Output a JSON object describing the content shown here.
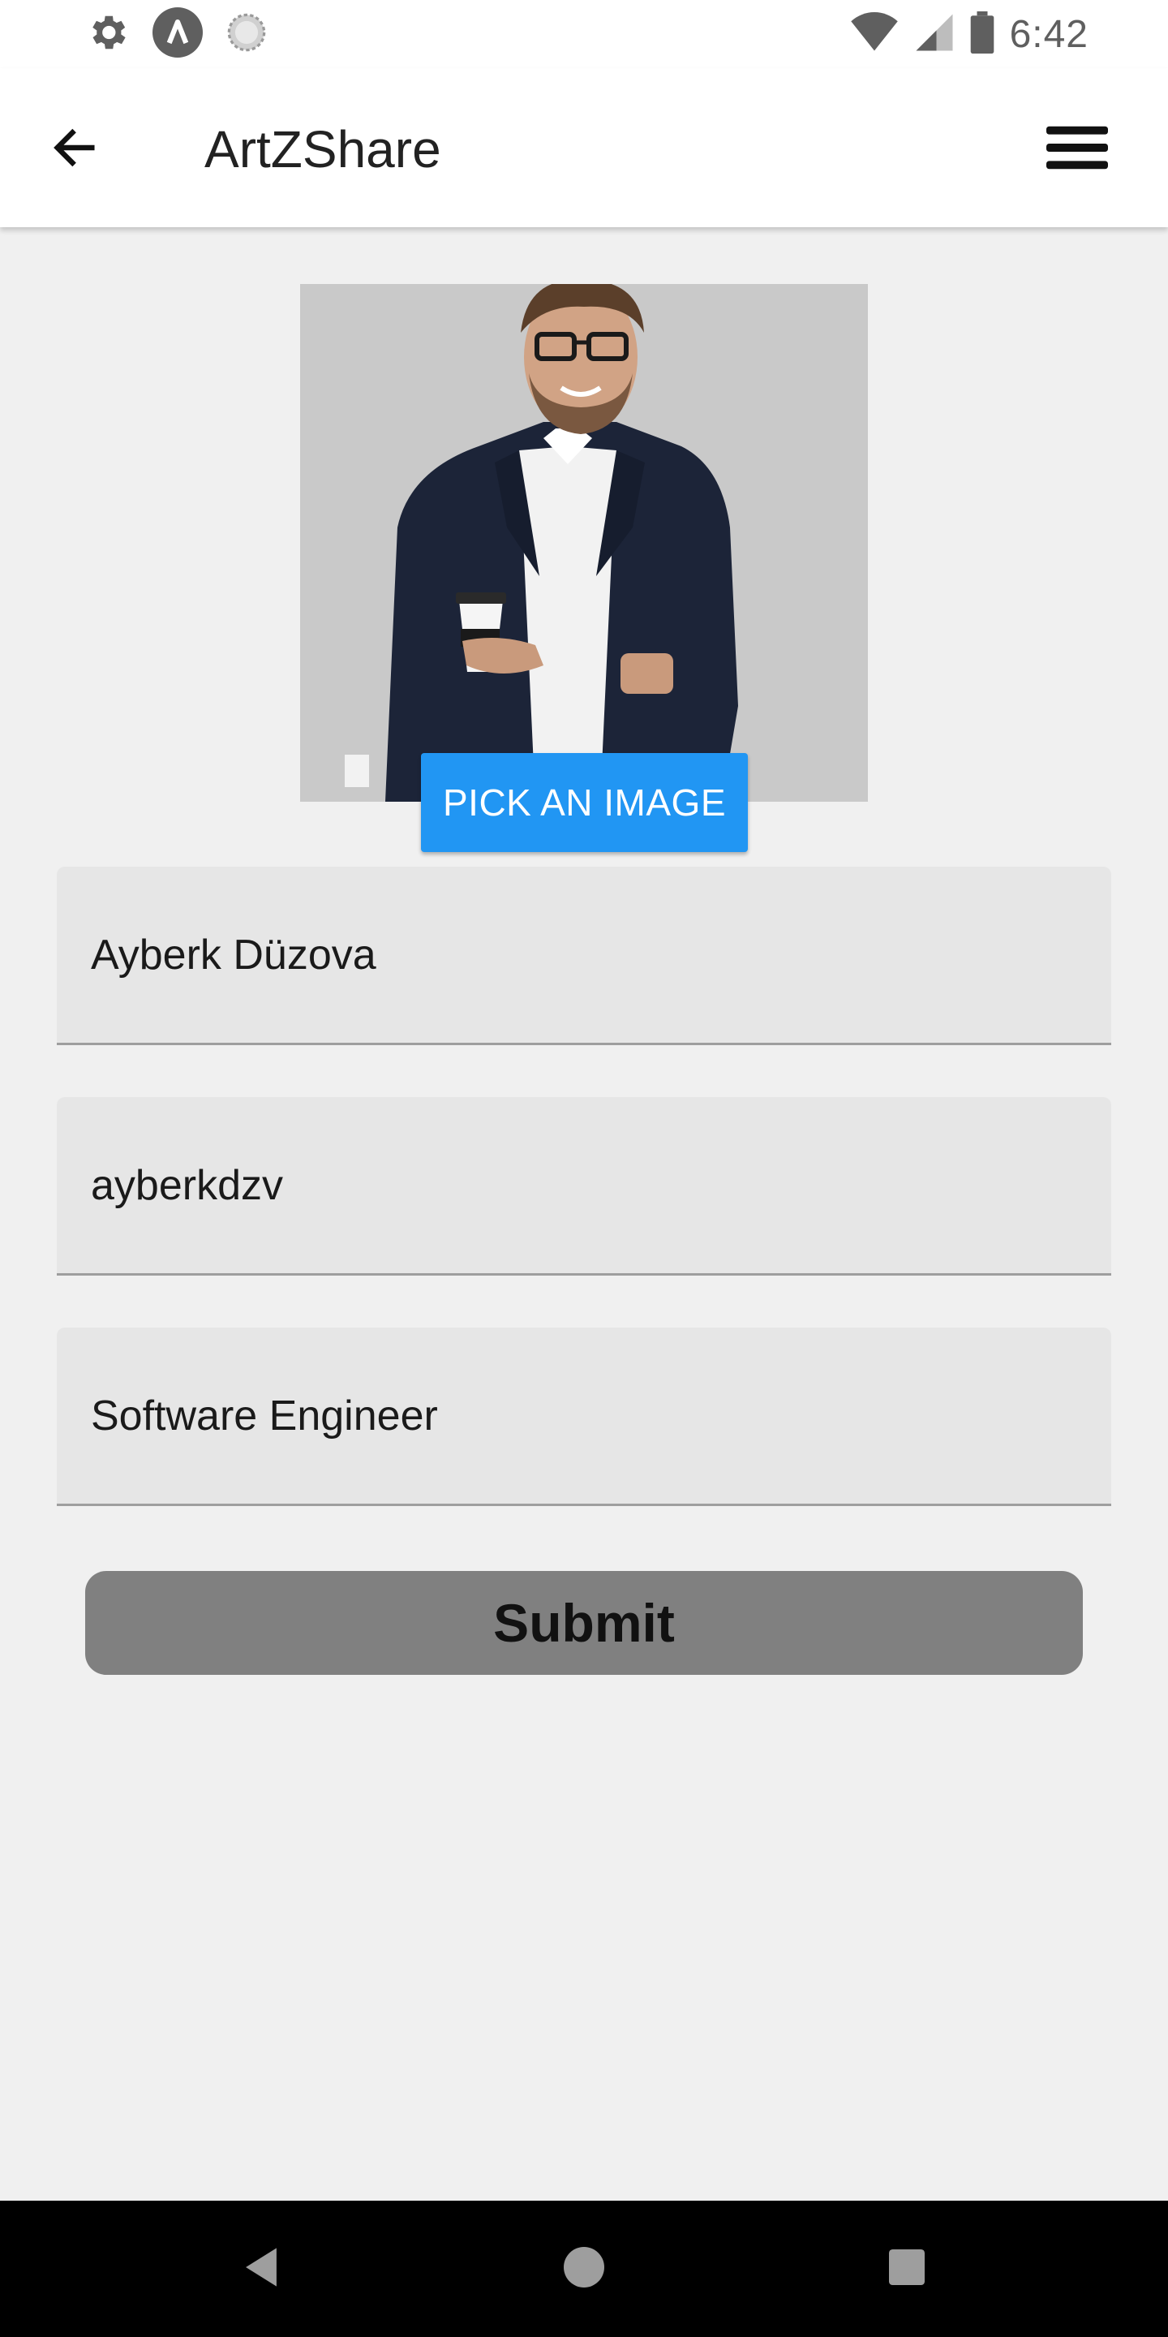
{
  "status_bar": {
    "time": "6:42",
    "left_icons": [
      "gear-icon",
      "app-a-icon",
      "loading-icon"
    ],
    "right_icons": [
      "wifi-icon",
      "signal-icon",
      "battery-icon"
    ]
  },
  "app_bar": {
    "title": "ArtZShare",
    "back_icon": "arrow-left-icon",
    "menu_icon": "hamburger-menu-icon"
  },
  "profile": {
    "photo_description": "profile-photo",
    "pick_image_label": "PICK AN IMAGE"
  },
  "form": {
    "name_value": "Ayberk Düzova",
    "username_value": "ayberkdzv",
    "title_value": "Software Engineer",
    "submit_label": "Submit"
  },
  "colors": {
    "accent": "#2196f3",
    "submit_bg": "#808080",
    "field_bg": "#e6e6e6",
    "page_bg": "#f0f0f0"
  },
  "nav_bar": {
    "icons": [
      "nav-back-icon",
      "nav-home-icon",
      "nav-recents-icon"
    ]
  }
}
